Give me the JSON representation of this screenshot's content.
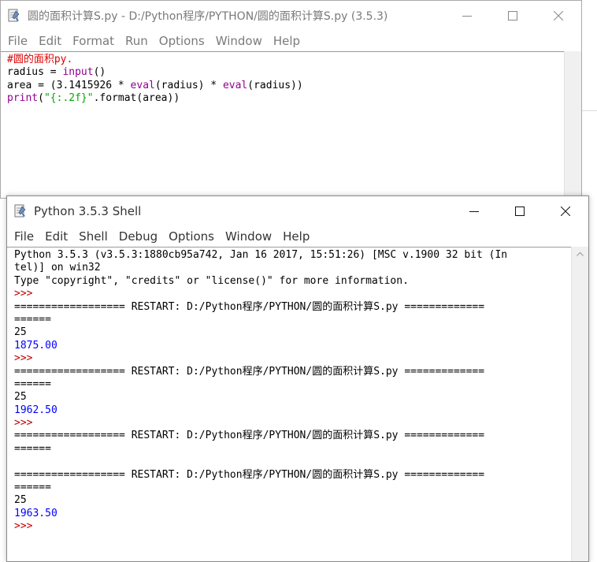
{
  "editor": {
    "title": "圆的面积计算S.py - D:/Python程序/PYTHON/圆的面积计算S.py (3.5.3)",
    "menu": [
      "File",
      "Edit",
      "Format",
      "Run",
      "Options",
      "Window",
      "Help"
    ],
    "code": [
      [
        {
          "t": "#圆的面积py.",
          "c": "comment"
        }
      ],
      [
        {
          "t": "radius = ",
          "c": "plain"
        },
        {
          "t": "input",
          "c": "builtin"
        },
        {
          "t": "()",
          "c": "plain"
        }
      ],
      [
        {
          "t": "area = (3.1415926 * ",
          "c": "plain"
        },
        {
          "t": "eval",
          "c": "builtin"
        },
        {
          "t": "(radius) * ",
          "c": "plain"
        },
        {
          "t": "eval",
          "c": "builtin"
        },
        {
          "t": "(radius))",
          "c": "plain"
        }
      ],
      [
        {
          "t": "print",
          "c": "builtin"
        },
        {
          "t": "(",
          "c": "plain"
        },
        {
          "t": "\"{:.2f}\"",
          "c": "string"
        },
        {
          "t": ".format(area))",
          "c": "plain"
        }
      ]
    ]
  },
  "shell": {
    "title": "Python 3.5.3 Shell",
    "menu": [
      "File",
      "Edit",
      "Shell",
      "Debug",
      "Options",
      "Window",
      "Help"
    ],
    "lines": [
      {
        "t": "Python 3.5.3 (v3.5.3:1880cb95a742, Jan 16 2017, 15:51:26) [MSC v.1900 32 bit (In",
        "c": "plain"
      },
      {
        "t": "tel)] on win32",
        "c": "plain"
      },
      {
        "t": "Type \"copyright\", \"credits\" or \"license()\" for more information.",
        "c": "plain"
      },
      {
        "t": ">>> ",
        "c": "prompt"
      },
      {
        "t": "================== RESTART: D:/Python程序/PYTHON/圆的面积计算S.py =============",
        "c": "plain"
      },
      {
        "t": "======",
        "c": "plain"
      },
      {
        "t": "25",
        "c": "plain"
      },
      {
        "t": "1875.00",
        "c": "output"
      },
      {
        "t": ">>> ",
        "c": "prompt"
      },
      {
        "t": "================== RESTART: D:/Python程序/PYTHON/圆的面积计算S.py =============",
        "c": "plain"
      },
      {
        "t": "======",
        "c": "plain"
      },
      {
        "t": "25",
        "c": "plain"
      },
      {
        "t": "1962.50",
        "c": "output"
      },
      {
        "t": ">>> ",
        "c": "prompt"
      },
      {
        "t": "================== RESTART: D:/Python程序/PYTHON/圆的面积计算S.py =============",
        "c": "plain"
      },
      {
        "t": "======",
        "c": "plain"
      },
      {
        "t": "",
        "c": "plain"
      },
      {
        "t": "================== RESTART: D:/Python程序/PYTHON/圆的面积计算S.py =============",
        "c": "plain"
      },
      {
        "t": "======",
        "c": "plain"
      },
      {
        "t": "25",
        "c": "plain"
      },
      {
        "t": "1963.50",
        "c": "output"
      },
      {
        "t": ">>> ",
        "c": "prompt"
      }
    ]
  },
  "icons": {
    "app": "python-idle-icon",
    "minimize": "minimize-icon",
    "maximize": "maximize-icon",
    "close": "close-icon",
    "scroll_up": "scroll-up-arrow-icon"
  },
  "colors": {
    "comment": "#dd0000",
    "builtin": "#900090",
    "string": "#00aa00",
    "prompt": "#c00000",
    "output": "#0000ff"
  }
}
